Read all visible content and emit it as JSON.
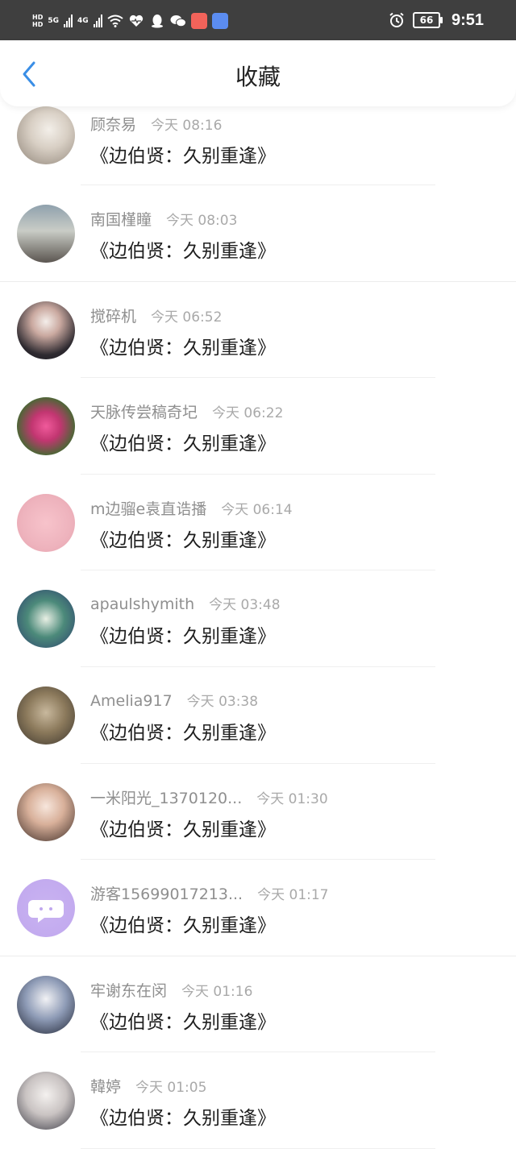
{
  "status_bar": {
    "hd_top": "HD",
    "hd_bottom": "HD",
    "net1": "5G",
    "net2": "4G",
    "battery": "66",
    "time": "9:51"
  },
  "nav": {
    "title": "收藏"
  },
  "favorites": [
    {
      "name": "顾奈易",
      "time": "今天 08:16",
      "title": "《边伯贤：久别重逢》"
    },
    {
      "name": "南国槿瞳",
      "time": "今天 08:03",
      "title": "《边伯贤：久别重逢》"
    },
    {
      "name": "搅碎机",
      "time": "今天 06:52",
      "title": "《边伯贤：久别重逢》"
    },
    {
      "name": "天脉传尝稿奇圮",
      "time": "今天 06:22",
      "title": "《边伯贤：久别重逢》"
    },
    {
      "name": "m边骝e袁直诰播",
      "time": "今天 06:14",
      "title": "《边伯贤：久别重逢》"
    },
    {
      "name": "apaulshymith",
      "time": "今天 03:48",
      "title": "《边伯贤：久别重逢》"
    },
    {
      "name": "Amelia917",
      "time": "今天 03:38",
      "title": "《边伯贤：久别重逢》"
    },
    {
      "name": "一米阳光_1370120...",
      "time": "今天 01:30",
      "title": "《边伯贤：久别重逢》"
    },
    {
      "name": "游客15699017213...",
      "time": "今天 01:17",
      "title": "《边伯贤：久别重逢》"
    },
    {
      "name": "牢谢东在闵",
      "time": "今天 01:16",
      "title": "《边伯贤：久别重逢》"
    },
    {
      "name": "韓婷",
      "time": "今天 01:05",
      "title": "《边伯贤：久别重逢》"
    }
  ]
}
